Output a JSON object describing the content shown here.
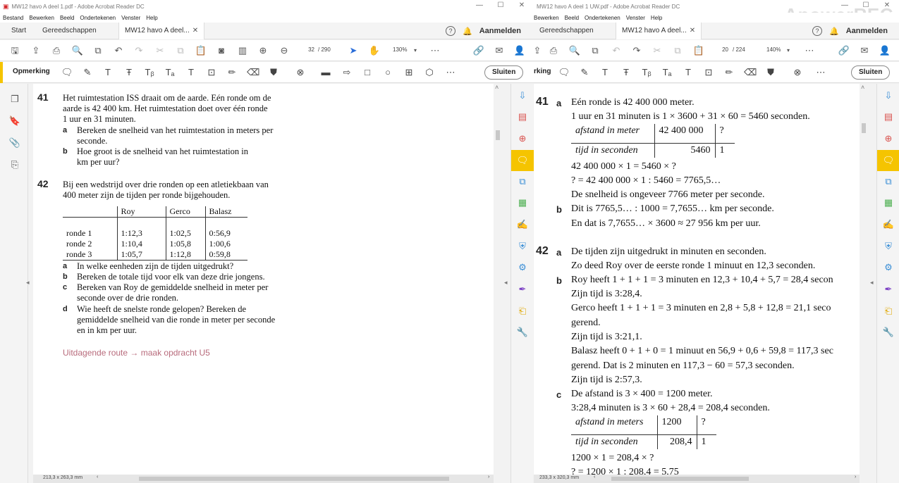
{
  "left_window": {
    "title": "MW12 havo A deel 1.pdf - Adobe Acrobat Reader DC",
    "menu": [
      "Bestand",
      "Bewerken",
      "Beeld",
      "Ondertekenen",
      "Venster",
      "Help"
    ],
    "tabs": {
      "start": "Start",
      "tools": "Gereedschappen",
      "doc": "MW12 havo A deel..."
    },
    "signin": "Aanmelden",
    "page_current": "32",
    "page_total": "/ 290",
    "zoom": "130%",
    "comment_label": "Opmerking",
    "close_label": "Sluiten",
    "status_size": "213,3 x 263,3 mm",
    "content": {
      "q41_num": "41",
      "q41_lines": [
        "Het ruimtestation ISS draait om de aarde. Eén ronde om de",
        "aarde is 42 400 km. Het ruimtestation doet over één ronde",
        "1 uur en 31 minuten."
      ],
      "q41_a": "Bereken de snelheid van het ruimtestation in meters per",
      "q41_a2": "seconde.",
      "q41_b": "Hoe groot is de snelheid van het ruimtestation in",
      "q41_b2": "km per uur?",
      "q42_num": "42",
      "q42_lines": [
        "Bij een wedstrijd over drie ronden op een atletiekbaan van",
        "400 meter zijn de tijden per ronde bijgehouden."
      ],
      "table_header": [
        "",
        "Roy",
        "Gerco",
        "Balasz"
      ],
      "table_rows": [
        [
          "ronde 1",
          "1:12,3",
          "1:02,5",
          "0:56,9"
        ],
        [
          "ronde 2",
          "1:10,4",
          "1:05,8",
          "1:00,6"
        ],
        [
          "ronde 3",
          "1:05,7",
          "1:12,8",
          "0:59,8"
        ]
      ],
      "q42_a": "In welke eenheden zijn de tijden uitgedrukt?",
      "q42_b": "Bereken de totale tijd voor elk van deze drie jongens.",
      "q42_c": "Bereken van Roy de gemiddelde snelheid in meter per",
      "q42_c2": "seconde over de drie ronden.",
      "q42_d": "Wie heeft de snelste ronde gelopen? Bereken de",
      "q42_d2": "gemiddelde snelheid van die ronde in meter per seconde",
      "q42_d3": "en in km per uur.",
      "route": "Uitdagende route → maak opdracht U5"
    }
  },
  "right_window": {
    "title": "MW12 havo A deel 1 UW.pdf - Adobe Acrobat Reader DC",
    "menu": [
      "Bewerken",
      "Beeld",
      "Ondertekenen",
      "Venster",
      "Help"
    ],
    "tabs": {
      "tools": "Gereedschappen",
      "doc": "MW12 havo A deel..."
    },
    "signin": "Aanmelden",
    "page_current": "20",
    "page_total": "/ 224",
    "zoom": "140%",
    "comment_label": "rking",
    "close_label": "Sluiten",
    "status_size": "233,3 x 320,3 mm",
    "watermark": "ApowerREC",
    "content": {
      "a41_num": "41",
      "a41_a_label": "a",
      "a41_lines": [
        "Eén ronde is 42 400 000 meter.",
        "1 uur en 31 minuten is 1 × 3600 + 31 × 60 = 5460 seconden."
      ],
      "t1": {
        "r1c1": "afstand in meter",
        "r1c2": "42 400 000",
        "r1c3": "?",
        "r2c1": "tijd in seconden",
        "r2c2": "5460",
        "r2c3": "1"
      },
      "a41_calc": [
        "42 400 000 × 1 = 5460 × ?",
        "? = 42 400 000 × 1 : 5460 = 7765,5…",
        "De snelheid is ongeveer 7766 meter per seconde."
      ],
      "a41_b_label": "b",
      "a41_b": [
        "Dit is 7765,5… : 1000 = 7,7655… km per seconde.",
        "En dat is 7,7655… × 3600 ≈ 27 956 km per uur."
      ],
      "a42_num": "42",
      "a42_a_label": "a",
      "a42_a": [
        "De tijden zijn uitgedrukt in minuten en seconden.",
        "Zo deed Roy over de eerste ronde 1 minuut en 12,3 seconden."
      ],
      "a42_b_label": "b",
      "a42_b": [
        "Roy heeft 1 + 1 + 1 = 3 minuten en 12,3 + 10,4 + 5,7 = 28,4 secon",
        "Zijn tijd is 3:28,4.",
        "Gerco heeft 1 + 1 + 1 = 3 minuten en 2,8 + 5,8 + 12,8 = 21,1 seco",
        "gerend.",
        "Zijn tijd is 3:21,1.",
        "Balasz heeft 0 + 1 + 0 = 1 minuut en 56,9 + 0,6 + 59,8 = 117,3 sec",
        "gerend. Dat is 2 minuten en 117,3 − 60 = 57,3 seconden.",
        "Zijn tijd is 2:57,3."
      ],
      "a42_c_label": "c",
      "a42_c": [
        "De afstand is 3 × 400 = 1200 meter.",
        "3:28,4 minuten is 3 × 60 + 28,4 = 208,4 seconden."
      ],
      "t2": {
        "r1c1": "afstand in meters",
        "r1c2": "1200",
        "r1c3": "?",
        "r2c1": "tijd in seconden",
        "r2c2": "208,4",
        "r2c3": "1"
      },
      "a42_c_calc": [
        "1200 × 1 = 208,4 × ?",
        "? = 1200 × 1 : 208,4 = 5,75"
      ]
    }
  },
  "colors": {
    "accent": "#f5c400",
    "route": "#b86b7c",
    "rail_icons": "#3b8fd6"
  }
}
